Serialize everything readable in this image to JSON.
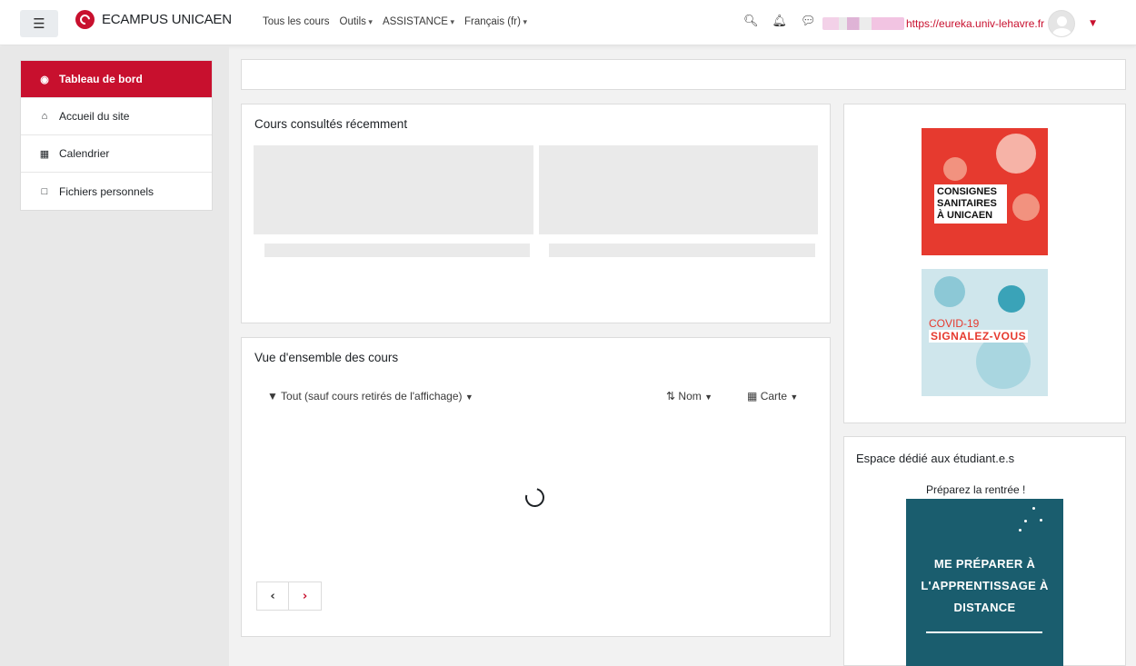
{
  "navbar": {
    "brand": "ECAMPUS UNICAEN",
    "links": [
      {
        "label": "Tous les cours",
        "dropdown": false
      },
      {
        "label": "Outils",
        "dropdown": true
      },
      {
        "label": "ASSISTANCE",
        "dropdown": true
      },
      {
        "label": "Français (fr)",
        "dropdown": true
      }
    ],
    "user_link": "https://eureka.univ-lehavre.fr"
  },
  "sidebar": {
    "items": [
      {
        "label": "Tableau de bord",
        "icon": "dashboard-icon",
        "active": true
      },
      {
        "label": "Accueil du site",
        "icon": "home-icon",
        "active": false
      },
      {
        "label": "Calendrier",
        "icon": "calendar-icon",
        "active": false
      },
      {
        "label": "Fichiers personnels",
        "icon": "file-icon",
        "active": false
      }
    ]
  },
  "recent": {
    "title": "Cours consultés récemment"
  },
  "overview": {
    "title": "Vue d'ensemble des cours",
    "filter_label": "Tout (sauf cours retirés de l'affichage)",
    "sort_label": "Nom",
    "view_label": "Carte"
  },
  "blocks": {
    "banner1_text": "CONSIGNES SANITAIRES À UNICAEN",
    "banner2_line1": "COVID-19",
    "banner2_line2": "SIGNALEZ-VOUS",
    "students_title": "Espace dédié aux étudiant.e.s",
    "prep_label": "Préparez la rentrée !",
    "banner3_text": "ME PRÉPARER À L'APPRENTISSAGE À DISTANCE"
  },
  "colors": {
    "accent": "#c8102e",
    "banner_red": "#e63a2f",
    "banner_blue": "#cfe6ec",
    "banner_teal": "#1a5d6e"
  }
}
